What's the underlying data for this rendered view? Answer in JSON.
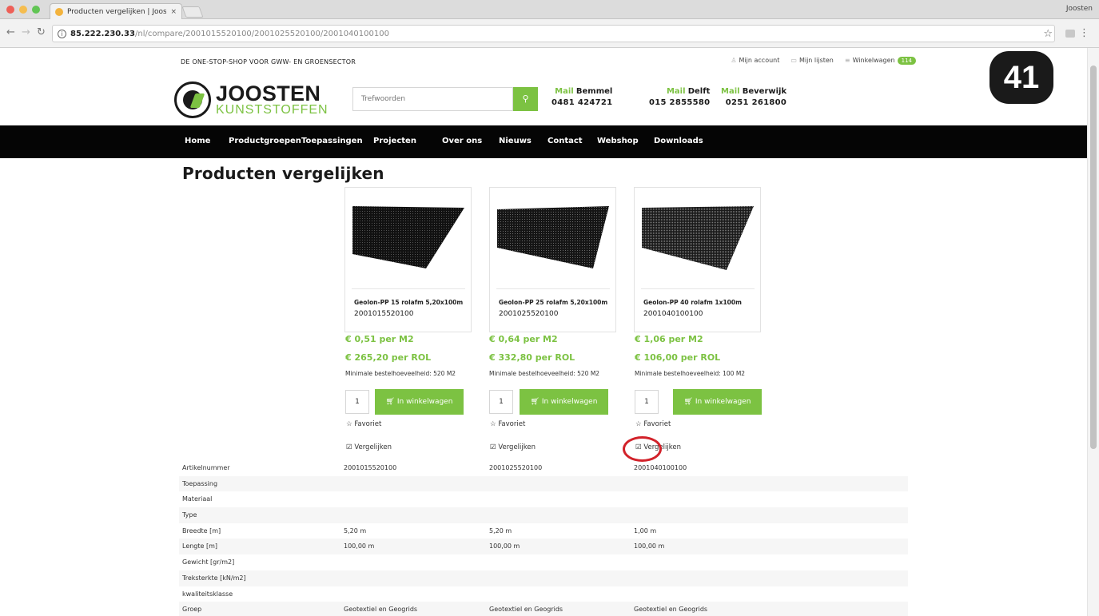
{
  "browser": {
    "tab_title": "Producten vergelijken | Jooste",
    "tab_close": "×",
    "profile": "Joosten",
    "url_host": "85.222.230.33",
    "url_path": "/nl/compare/2001015520100/2001025520100/2001040100100"
  },
  "site": {
    "tagline": "DE ONE-STOP-SHOP VOOR GWW- EN GROENSECTOR",
    "account_label": "Mijn account",
    "lists_label": "Mijn lijsten",
    "cart_label": "Winkelwagen",
    "cart_count": "114",
    "logo_line1": "JOOSTEN",
    "logo_line2": "KUNSTSTOFFEN",
    "search_placeholder": "Trefwoorden",
    "phones": [
      {
        "bel": "Mail",
        "city": "Bemmel",
        "number": "0481 424721"
      },
      {
        "bel": "Mail",
        "city": "Delft",
        "number": "015 2855580"
      },
      {
        "bel": "Mail",
        "city": "Beverwijk",
        "number": "0251 261800"
      }
    ],
    "nav": [
      "Home",
      "Productgroepen",
      "Toepassingen",
      "Projecten",
      "Over ons",
      "Nieuws",
      "Contact",
      "Webshop",
      "Downloads"
    ]
  },
  "page_title": "Producten vergelijken",
  "products": [
    {
      "name": "Geolon-PP 15 rolafm 5,20x100m",
      "code": "2001015520100",
      "price_m2": "€ 0,51 per M2",
      "price_rol": "€ 265,20 per ROL",
      "min_order": "Minimale bestelhoeveelheid: 520 M2",
      "qty": "1",
      "add_label": "In winkelwagen",
      "fav_label": "Favoriet",
      "compare_label": "Vergelijken"
    },
    {
      "name": "Geolon-PP 25 rolafm 5,20x100m",
      "code": "2001025520100",
      "price_m2": "€ 0,64 per M2",
      "price_rol": "€ 332,80 per ROL",
      "min_order": "Minimale bestelhoeveelheid: 520 M2",
      "qty": "1",
      "add_label": "In winkelwagen",
      "fav_label": "Favoriet",
      "compare_label": "Vergelijken"
    },
    {
      "name": "Geolon-PP 40 rolafm 1x100m",
      "code": "2001040100100",
      "price_m2": "€ 1,06 per M2",
      "price_rol": "€ 106,00 per ROL",
      "min_order": "Minimale bestelhoeveelheid: 100 M2",
      "qty": "1",
      "add_label": "In winkelwagen",
      "fav_label": "Favoriet",
      "compare_label": "Vergelijken"
    }
  ],
  "specs": [
    {
      "label": "Artikelnummer",
      "values": [
        "2001015520100",
        "2001025520100",
        "2001040100100"
      ]
    },
    {
      "label": "Toepassing",
      "values": [
        "",
        "",
        ""
      ]
    },
    {
      "label": "Materiaal",
      "values": [
        "",
        "",
        ""
      ]
    },
    {
      "label": "Type",
      "values": [
        "",
        "",
        ""
      ]
    },
    {
      "label": "Breedte [m]",
      "values": [
        "5,20 m",
        "5,20 m",
        "1,00 m"
      ]
    },
    {
      "label": "Lengte [m]",
      "values": [
        "100,00 m",
        "100,00 m",
        "100,00 m"
      ]
    },
    {
      "label": "Gewicht [gr/m2]",
      "values": [
        "",
        "",
        ""
      ]
    },
    {
      "label": "Treksterkte [kN/m2]",
      "values": [
        "",
        "",
        ""
      ]
    },
    {
      "label": "kwaliteitsklasse",
      "values": [
        "",
        "",
        ""
      ]
    },
    {
      "label": "Groep",
      "values": [
        "Geotextiel en Geogrids",
        "Geotextiel en Geogrids",
        "Geotextiel en Geogrids"
      ]
    }
  ],
  "step_badge": "41",
  "colors": {
    "accent": "#7cc242",
    "nav_bg": "#050505",
    "highlight": "#d2222a"
  }
}
